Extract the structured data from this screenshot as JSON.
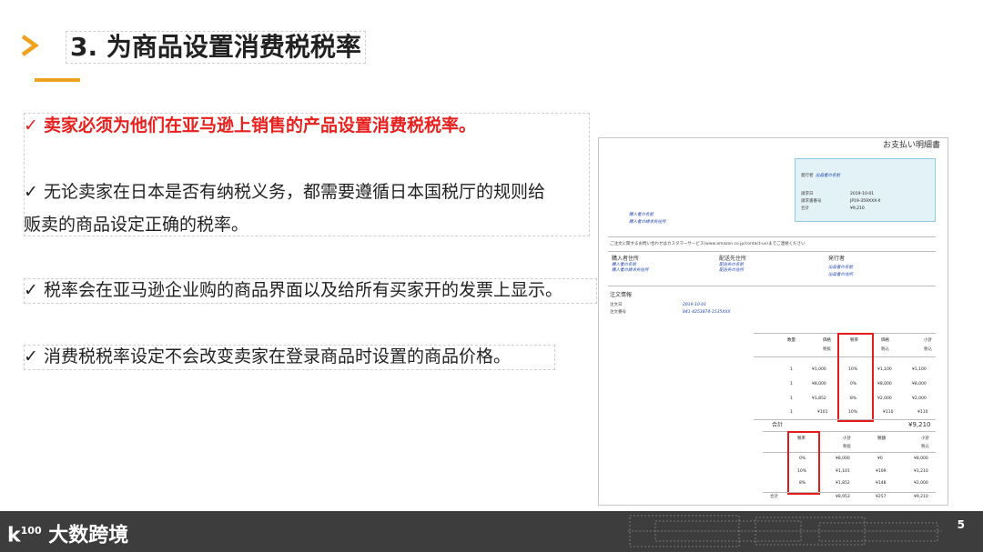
{
  "title": "3. 为商品设置消费税税率",
  "bullets": {
    "b1": "卖家必须为他们在亚马逊上销售的产品设置消费税税率。",
    "b2_line1": "无论卖家在日本是否有纳税义务，都需要遵循日本国税厅的规则给",
    "b2_line2": "贩卖的商品设定正确的税率。",
    "b3": "税率会在亚马逊企业购的商品界面以及给所有买家开的发票上显示。",
    "b4": "消费税税率设定不会改变卖家在登录商品时设置的商品价格。"
  },
  "check_mark": "✓",
  "invoice": {
    "heading": "お支払い明細書",
    "issuer_label": "発行者",
    "issuer_name": "出品者の名前",
    "date_label": "請求日",
    "date_value": "2019-10-01",
    "invoice_no_label": "請求書番号",
    "invoice_no_value": "JP19-359XXX-X",
    "total_label": "合計",
    "total_value": "¥9,210",
    "buyer_name": "購入者の名前",
    "buyer_address": "購入者の請求先住所",
    "contact_note": "ご注文に関するお問い合わせはカスタマーサービス(www.amazon.co.jp/contact-us)までご連絡ください",
    "col1_title": "購入者住所",
    "col1_lines": [
      "購入者の名前",
      "購入者の請求先住所"
    ],
    "col2_title": "配送先住所",
    "col2_lines": [
      "配送先の名前",
      "配送先の住所"
    ],
    "col3_title": "発行者",
    "col3_lines": [
      "出品者の名前",
      "出品者の住所"
    ],
    "order_info_title": "注文情報",
    "order_date_label": "注文日",
    "order_date_value": "2019-10-01",
    "order_no_label": "注文番号",
    "order_no_value": "841-4253874-1535XXX",
    "items_headers": [
      "数量",
      "価格",
      "税率",
      "価格",
      "小計"
    ],
    "items_subheaders": [
      "税抜",
      "税込",
      "税込"
    ],
    "items": [
      {
        "qty": "1",
        "price": "¥1,000",
        "rate": "10%",
        "incl": "¥1,100",
        "subtotal": "¥1,100"
      },
      {
        "qty": "1",
        "price": "¥8,000",
        "rate": "0%",
        "incl": "¥8,000",
        "subtotal": "¥8,000"
      },
      {
        "qty": "1",
        "price": "¥1,852",
        "rate": "8%",
        "incl": "¥2,000",
        "subtotal": "¥2,000"
      },
      {
        "qty": "1",
        "price": "¥101",
        "rate": "10%",
        "incl": "¥110",
        "subtotal": "¥110"
      }
    ],
    "sum_label": "合計",
    "sum_value": "¥9,210",
    "summary_headers": [
      "税率",
      "小計",
      "税額",
      "小計"
    ],
    "summary_subheaders": [
      "税抜",
      "税込"
    ],
    "summary_rows": [
      {
        "rate": "0%",
        "net": "¥8,000",
        "tax": "¥0",
        "gross": "¥8,000"
      },
      {
        "rate": "10%",
        "net": "¥1,101",
        "tax": "¥109",
        "gross": "¥1,210"
      },
      {
        "rate": "8%",
        "net": "¥1,852",
        "tax": "¥148",
        "gross": "¥2,000"
      }
    ],
    "summary_total": {
      "label": "合計",
      "net": "¥8,953",
      "tax": "¥257",
      "gross": "¥9,210"
    }
  },
  "footer": {
    "logo_prefix": "k",
    "logo_sup": "100",
    "logo_text": "大数跨境",
    "page_number": "5"
  },
  "colors": {
    "accent": "#f0a11e",
    "red": "#e8201e",
    "footer_bg": "#3d3d3d"
  }
}
